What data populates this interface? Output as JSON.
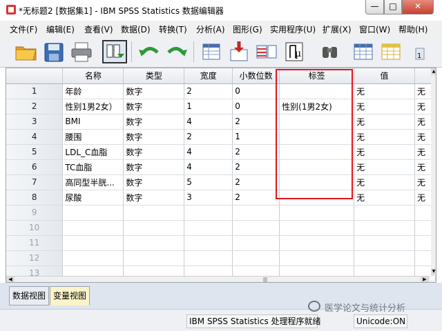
{
  "window": {
    "title": "*无标题2 [数据集1] - IBM SPSS Statistics 数据编辑器",
    "min_label": "—",
    "max_label": "□",
    "close_label": "✕"
  },
  "menu": [
    {
      "label": "文件(F)"
    },
    {
      "label": "编辑(E)"
    },
    {
      "label": "查看(V)"
    },
    {
      "label": "数据(D)"
    },
    {
      "label": "转换(T)"
    },
    {
      "label": "分析(A)"
    },
    {
      "label": "图形(G)"
    },
    {
      "label": "实用程序(U)"
    },
    {
      "label": "扩展(X)"
    },
    {
      "label": "窗口(W)"
    },
    {
      "label": "帮助(H)"
    }
  ],
  "toolbar": {
    "icons": [
      "open-folder-icon",
      "save-icon",
      "print-icon",
      "dialog-recall-icon",
      "undo-icon",
      "redo-icon",
      "goto-case-icon",
      "goto-variable-icon",
      "variables-icon",
      "run-descriptives-icon",
      "find-icon",
      "insert-cases-icon",
      "insert-variable-icon"
    ]
  },
  "grid": {
    "headers": [
      "名称",
      "类型",
      "宽度",
      "小数位数",
      "标签",
      "值"
    ],
    "rows": [
      {
        "num": "1",
        "name": "年龄",
        "type": "数字",
        "width": "2",
        "decimals": "0",
        "label": "",
        "values": "无",
        "values_next": "无"
      },
      {
        "num": "2",
        "name": "性别1男2女）",
        "type": "数字",
        "width": "1",
        "decimals": "0",
        "label": "性别(1男2女)",
        "values": "无",
        "values_next": "无"
      },
      {
        "num": "3",
        "name": "BMI",
        "type": "数字",
        "width": "4",
        "decimals": "2",
        "label": "",
        "values": "无",
        "values_next": "无"
      },
      {
        "num": "4",
        "name": "腰围",
        "type": "数字",
        "width": "2",
        "decimals": "1",
        "label": "",
        "values": "无",
        "values_next": "无"
      },
      {
        "num": "5",
        "name": "LDL_C血脂",
        "type": "数字",
        "width": "4",
        "decimals": "2",
        "label": "",
        "values": "无",
        "values_next": "无"
      },
      {
        "num": "6",
        "name": "TC血脂",
        "type": "数字",
        "width": "4",
        "decimals": "2",
        "label": "",
        "values": "无",
        "values_next": "无"
      },
      {
        "num": "7",
        "name": "高同型半胱...",
        "type": "数字",
        "width": "5",
        "decimals": "2",
        "label": "",
        "values": "无",
        "values_next": "无"
      },
      {
        "num": "8",
        "name": "尿酸",
        "type": "数字",
        "width": "3",
        "decimals": "2",
        "label": "",
        "values": "无",
        "values_next": "无"
      }
    ],
    "empty_rows": [
      "9",
      "10",
      "11",
      "12",
      "13"
    ]
  },
  "tabs": {
    "data_view": "数据视图",
    "variable_view": "变量视图"
  },
  "status": {
    "processor": "IBM SPSS Statistics 处理程序就绪",
    "unicode": "Unicode:ON"
  },
  "watermark": {
    "text": "医学论文与统计分析"
  },
  "colors": {
    "highlight": "#e0141c",
    "active_tab": "#fbf3c9"
  }
}
